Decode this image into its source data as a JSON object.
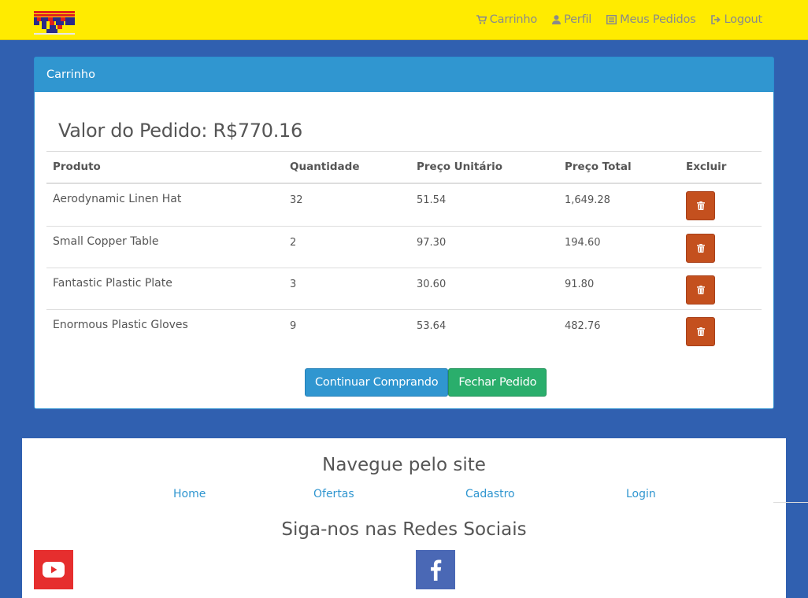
{
  "nav": {
    "items": [
      {
        "label": "Carrinho",
        "icon": "cart-icon"
      },
      {
        "label": "Perfil",
        "icon": "user-icon"
      },
      {
        "label": "Meus Pedidos",
        "icon": "list-icon"
      },
      {
        "label": "Logout",
        "icon": "logout-icon"
      }
    ]
  },
  "cart": {
    "heading": "Carrinho",
    "order_value": "Valor do Pedido: R$770.16",
    "columns": [
      "Produto",
      "Quantidade",
      "Preço Unitário",
      "Preço Total",
      "Excluir"
    ],
    "rows": [
      {
        "product": "Aerodynamic Linen Hat",
        "qty": "32",
        "unit": "51.54",
        "total": "1,649.28"
      },
      {
        "product": "Small Copper Table",
        "qty": "2",
        "unit": "97.30",
        "total": "194.60"
      },
      {
        "product": "Fantastic Plastic Plate",
        "qty": "3",
        "unit": "30.60",
        "total": "91.80"
      },
      {
        "product": "Enormous Plastic Gloves",
        "qty": "9",
        "unit": "53.64",
        "total": "482.76"
      }
    ],
    "continue_label": "Continuar Comprando",
    "close_label": "Fechar Pedido"
  },
  "footer": {
    "nav_title": "Navegue pelo site",
    "links": [
      "Home",
      "Ofertas",
      "Cadastro",
      "Login"
    ],
    "social_title": "Siga-nos nas Redes Sociais",
    "social": [
      {
        "name": "youtube",
        "color": "#e62e2e"
      },
      {
        "name": "facebook",
        "color": "#4a68b5"
      }
    ]
  },
  "colors": {
    "navbar": "#ffeb00",
    "background": "#3060b0",
    "primary": "#3096d0",
    "success": "#2aae6c",
    "danger": "#c4501e"
  }
}
